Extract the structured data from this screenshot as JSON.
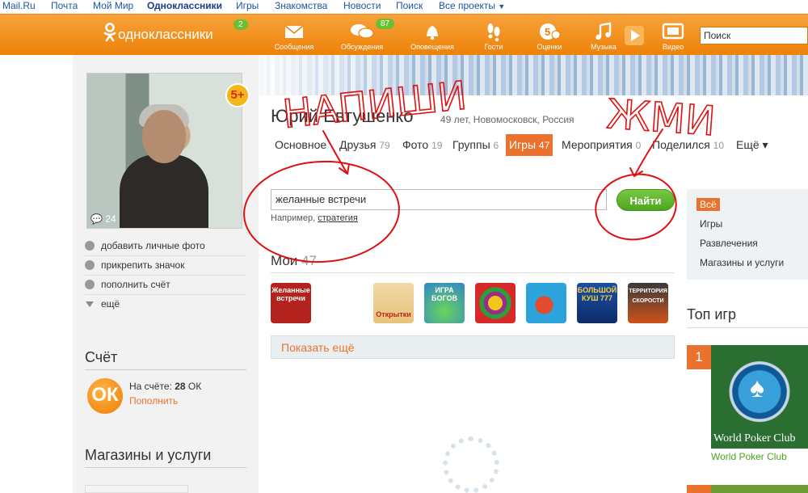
{
  "toplinks": [
    "Mail.Ru",
    "Почта",
    "Мой Мир",
    "Одноклассники",
    "Игры",
    "Знакомства",
    "Новости",
    "Поиск",
    "Все проекты"
  ],
  "header": {
    "logo": "одноклассники",
    "logo_badge": "2",
    "nav": [
      {
        "label": "Сообщения",
        "icon": "envelope-icon",
        "badge": ""
      },
      {
        "label": "Обсуждения",
        "icon": "chat-bubbles-icon",
        "badge": "87"
      },
      {
        "label": "Оповещения",
        "icon": "bell-icon",
        "badge": ""
      },
      {
        "label": "Гости",
        "icon": "footprints-icon",
        "badge": ""
      },
      {
        "label": "Оценки",
        "icon": "rating-icon",
        "badge": ""
      },
      {
        "label": "Музыка",
        "icon": "music-note-icon",
        "badge": ""
      },
      {
        "label": "Видео",
        "icon": "video-icon",
        "badge": ""
      }
    ],
    "search_placeholder": "Поиск"
  },
  "profile": {
    "name": "Юрий Евтушенко",
    "info": "49 лет, Новомосковск, Россия",
    "photo_comments": "24",
    "rating_badge": "5+",
    "actions": [
      "добавить личные фото",
      "прикрепить значок",
      "пополнить счёт",
      "ещё"
    ]
  },
  "tabs": [
    {
      "label": "Основное",
      "count": ""
    },
    {
      "label": "Друзья",
      "count": "79"
    },
    {
      "label": "Фото",
      "count": "19"
    },
    {
      "label": "Группы",
      "count": "6"
    },
    {
      "label": "Игры",
      "count": "47"
    },
    {
      "label": "Мероприятия",
      "count": "0"
    },
    {
      "label": "Поделился",
      "count": "10"
    },
    {
      "label": "Ещё ▾",
      "count": ""
    }
  ],
  "game_search": {
    "value": "желанные встречи",
    "button": "Найти",
    "hint_prefix": "Например,",
    "hint_link": "стратегия"
  },
  "my_games": {
    "title": "Мои",
    "count": "47",
    "icons": [
      {
        "name": "game-zhelannye-vstrechi",
        "text": "Желанные встречи",
        "color": "#b3221d"
      },
      {
        "name": "game-otkrytki",
        "text": "Открытки",
        "color": "#e9c37a"
      },
      {
        "name": "game-igra-bogov",
        "text": "ИГРА БОГОВ",
        "color": "#2f86c9"
      },
      {
        "name": "game-balls",
        "text": "",
        "color": "#9a2c8a"
      },
      {
        "name": "game-fish",
        "text": "",
        "color": "#2da3dc"
      },
      {
        "name": "game-bolshoy-kush",
        "text": "БОЛЬШОЙ КУШ 777",
        "color": "#1b4fa5"
      },
      {
        "name": "game-territoriya-skorosti",
        "text": "ТЕРРИТОРИЯ СКОРОСТИ",
        "color": "#d0511a"
      }
    ],
    "show_more": "Показать ещё"
  },
  "account": {
    "title": "Счёт",
    "balance_label": "На счёте:",
    "balance_value": "28",
    "currency": "ОК",
    "topup": "Пополнить",
    "coin_symbol": "ОК"
  },
  "shops": {
    "title": "Магазины и услуги"
  },
  "filters": [
    "Всё",
    "Игры",
    "Развлечения",
    "Магазины и услуги"
  ],
  "top_games": {
    "title": "Топ игр",
    "rank": "1",
    "game": "World Poker Club",
    "game_link": "World Poker Club"
  },
  "annotations": {
    "write": "НАПИШИ",
    "press": "ЖМИ"
  },
  "colors": {
    "brand_orange": "#ee8208",
    "accent": "#eb722e",
    "green": "#4da51e",
    "annotation": "#e01010"
  }
}
